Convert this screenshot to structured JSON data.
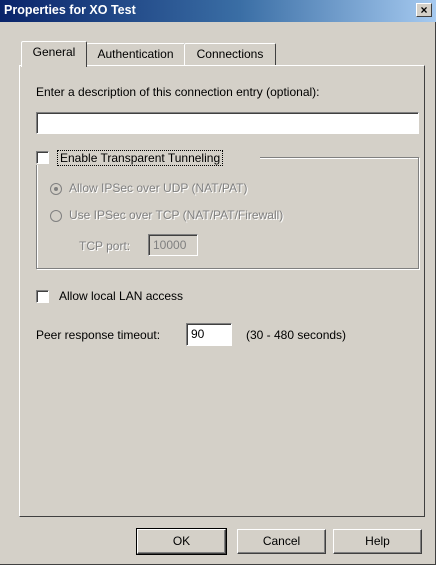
{
  "window": {
    "title": "Properties for XO Test",
    "close_glyph": "×"
  },
  "tabs": [
    {
      "label": "General",
      "active": true
    },
    {
      "label": "Authentication",
      "active": false
    },
    {
      "label": "Connections",
      "active": false
    }
  ],
  "general": {
    "description_label": "Enter a description of this connection entry (optional):",
    "description_value": "",
    "transparent_tunneling": {
      "label": "Enable Transparent Tunneling",
      "checked": false,
      "options": [
        {
          "label": "Allow IPSec over UDP  (NAT/PAT)",
          "selected": true,
          "enabled": false
        },
        {
          "label": "Use IPSec over TCP  (NAT/PAT/Firewall)",
          "selected": false,
          "enabled": false
        }
      ],
      "tcp_port_label": "TCP port:",
      "tcp_port_value": "10000"
    },
    "allow_local_lan": {
      "label": "Allow local LAN access",
      "checked": false
    },
    "peer_timeout": {
      "label": "Peer response timeout:",
      "value": "90",
      "range_hint": "(30 - 480 seconds)"
    }
  },
  "buttons": {
    "ok": "OK",
    "cancel": "Cancel",
    "help": "Help"
  }
}
